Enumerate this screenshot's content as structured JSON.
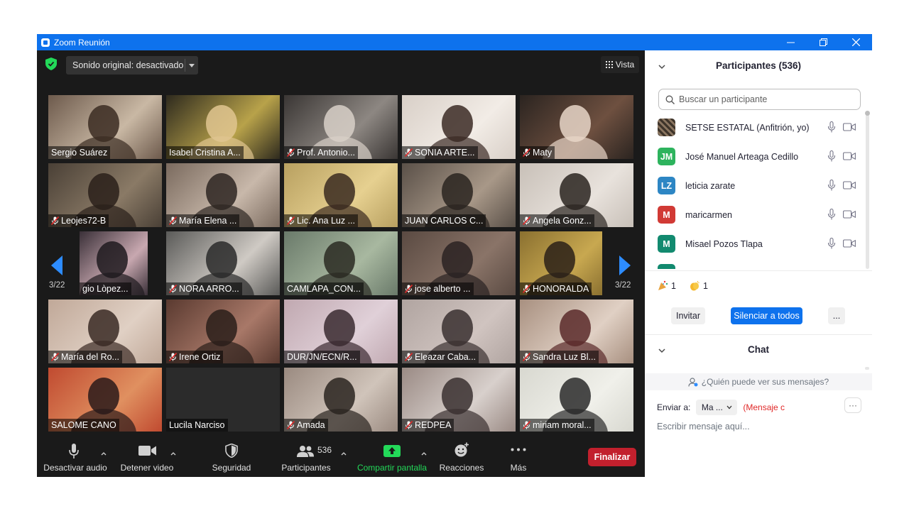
{
  "window": {
    "title": "Zoom Reunión"
  },
  "meeting": {
    "sound_label": "Sonido original: desactivado",
    "view_label": "Vista",
    "page_left": "3/22",
    "page_right": "3/22",
    "tiles": [
      {
        "name": "Sergio Suárez",
        "muted": false
      },
      {
        "name": "Isabel Cristina A...",
        "muted": false
      },
      {
        "name": "Prof. Antonio...",
        "muted": true
      },
      {
        "name": "SONIA ARTE...",
        "muted": true
      },
      {
        "name": "Maty",
        "muted": true
      },
      {
        "name": "Leojes72-B",
        "muted": true
      },
      {
        "name": "María Elena ...",
        "muted": true
      },
      {
        "name": "Lic. Ana Luz ...",
        "muted": true
      },
      {
        "name": "JUAN CARLOS C...",
        "muted": false
      },
      {
        "name": "Angela Gonz...",
        "muted": true
      },
      {
        "name": "gio Lòpez...",
        "muted": false
      },
      {
        "name": "NORA ARRO...",
        "muted": true
      },
      {
        "name": "CAMLAPA_CON...",
        "muted": false
      },
      {
        "name": "jose alberto ...",
        "muted": true
      },
      {
        "name": "HONORALDA",
        "muted": true
      },
      {
        "name": "María del Ro...",
        "muted": true
      },
      {
        "name": "Irene Ortiz",
        "muted": true
      },
      {
        "name": "DUR/JN/ECN/R...",
        "muted": false
      },
      {
        "name": "Eleazar Caba...",
        "muted": true
      },
      {
        "name": "Sandra Luz Bl...",
        "muted": true
      },
      {
        "name": "SALOME CANO",
        "muted": false
      },
      {
        "name": "Lucila Narciso",
        "muted": false
      },
      {
        "name": "Amada",
        "muted": true
      },
      {
        "name": "REDPEA",
        "muted": true
      },
      {
        "name": "miriam moral...",
        "muted": true
      }
    ]
  },
  "toolbar": {
    "audio_label": "Desactivar audio",
    "video_label": "Detener video",
    "security_label": "Seguridad",
    "participants_label": "Participantes",
    "participants_count": "536",
    "share_label": "Compartir pantalla",
    "reactions_label": "Reacciones",
    "more_label": "Más",
    "end_label": "Finalizar"
  },
  "panel": {
    "title": "Participantes (536)",
    "search_placeholder": "Buscar un participante",
    "participants": [
      {
        "initials": "",
        "name": "SETSE ESTATAL (Anfitrión, yo)",
        "color": "#6b5a48"
      },
      {
        "initials": "JM",
        "name": "José Manuel Arteaga Cedillo",
        "color": "#2db35d"
      },
      {
        "initials": "LZ",
        "name": "leticia zarate",
        "color": "#2d86c4"
      },
      {
        "initials": "M",
        "name": "maricarmen",
        "color": "#d13a35"
      },
      {
        "initials": "M",
        "name": "Misael Pozos Tlapa",
        "color": "#128a6f"
      }
    ],
    "reaction_tada_count": "1",
    "reaction_clap_count": "1",
    "invite_label": "Invitar",
    "mute_all_label": "Silenciar a todos",
    "more_label": "...",
    "chat_title": "Chat",
    "chat_visibility": "¿Quién puede ver sus mensajes?",
    "send_to_label": "Enviar a:",
    "send_to_value": "Ma ...",
    "send_to_hint": "(Mensaje c",
    "more_small": "···",
    "message_placeholder": "Escribir mensaje aquí..."
  }
}
